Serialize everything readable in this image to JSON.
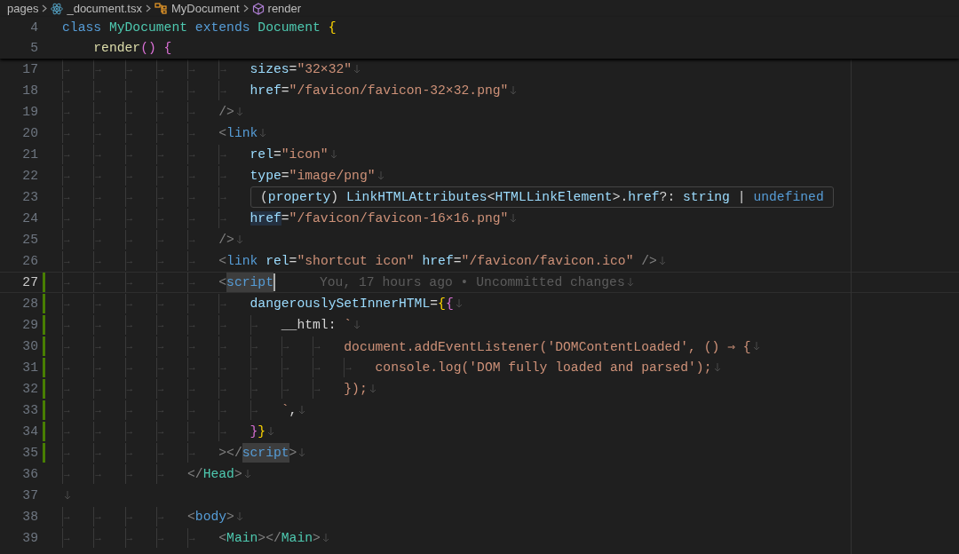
{
  "breadcrumb": [
    {
      "label": "pages",
      "kind": "folder"
    },
    {
      "label": "_document.tsx",
      "kind": "react-file"
    },
    {
      "label": "MyDocument",
      "kind": "class"
    },
    {
      "label": "render",
      "kind": "method"
    }
  ],
  "sticky_lines": [
    {
      "number": "4",
      "tokens": [
        {
          "text": "class ",
          "kind": "keyword"
        },
        {
          "text": "MyDocument",
          "kind": "type"
        },
        {
          "text": " extends ",
          "kind": "keyword"
        },
        {
          "text": "Document",
          "kind": "type"
        },
        {
          "text": " {",
          "kind": "bracket1"
        }
      ],
      "children": [
        {
          "number": "5",
          "tokens": [
            {
              "text": "render",
              "kind": "func"
            },
            {
              "text": "()",
              "kind": "bracket2"
            },
            {
              "text": " {",
              "kind": "bracket2"
            }
          ]
        }
      ]
    }
  ],
  "lines": [
    {
      "number": "17",
      "indent": [
        "→",
        "→",
        "→",
        "→",
        "→",
        "→"
      ],
      "current": false,
      "modified": false,
      "tokens": [
        {
          "text": "sizes",
          "kind": "attr"
        },
        {
          "text": "=",
          "kind": "plain"
        },
        {
          "text": "\"32×32\"",
          "kind": "string"
        }
      ]
    },
    {
      "number": "18",
      "indent": [
        "→",
        "→",
        "→",
        "→",
        "→",
        "→"
      ],
      "current": false,
      "modified": false,
      "tokens": [
        {
          "text": "href",
          "kind": "attr"
        },
        {
          "text": "=",
          "kind": "plain"
        },
        {
          "text": "\"/favicon/favicon-32×32.png\"",
          "kind": "string"
        }
      ]
    },
    {
      "number": "19",
      "indent": [
        "→",
        "→",
        "→",
        "→",
        "→"
      ],
      "current": false,
      "modified": false,
      "tokens": [
        {
          "text": "/>",
          "kind": "punct"
        }
      ]
    },
    {
      "number": "20",
      "indent": [
        "→",
        "→",
        "→",
        "→",
        "→"
      ],
      "current": false,
      "modified": false,
      "tokens": [
        {
          "text": "<",
          "kind": "punct"
        },
        {
          "text": "link",
          "kind": "tag"
        }
      ]
    },
    {
      "number": "21",
      "indent": [
        "→",
        "→",
        "→",
        "→",
        "→",
        "→"
      ],
      "current": false,
      "modified": false,
      "tokens": [
        {
          "text": "rel",
          "kind": "attr"
        },
        {
          "text": "=",
          "kind": "plain"
        },
        {
          "text": "\"icon\"",
          "kind": "string"
        }
      ]
    },
    {
      "number": "22",
      "indent": [
        "→",
        "→",
        "→",
        "→",
        "→",
        "→"
      ],
      "current": false,
      "modified": false,
      "tokens": [
        {
          "text": "type",
          "kind": "attr"
        },
        {
          "text": "=",
          "kind": "plain"
        },
        {
          "text": "\"image/png\"",
          "kind": "string"
        }
      ]
    },
    {
      "number": "23",
      "indent": [
        "→",
        "→",
        "→",
        "→",
        "→",
        "→"
      ],
      "current": false,
      "modified": false
    },
    {
      "number": "24",
      "indent": [
        "→",
        "→",
        "→",
        "→",
        "→",
        "→"
      ],
      "current": false,
      "modified": false,
      "tokens": [
        {
          "text": "href",
          "kind": "attr-hover"
        },
        {
          "text": "=",
          "kind": "plain"
        },
        {
          "text": "\"/favicon/favicon-16×16.png\"",
          "kind": "string"
        }
      ]
    },
    {
      "number": "25",
      "indent": [
        "→",
        "→",
        "→",
        "→",
        "→"
      ],
      "current": false,
      "modified": false,
      "tokens": [
        {
          "text": "/>",
          "kind": "punct"
        }
      ]
    },
    {
      "number": "26",
      "indent": [
        "→",
        "→",
        "→",
        "→",
        "→"
      ],
      "current": false,
      "modified": false,
      "tokens": [
        {
          "text": "<",
          "kind": "punct"
        },
        {
          "text": "link",
          "kind": "tag"
        },
        {
          "text": " rel",
          "kind": "attr"
        },
        {
          "text": "=",
          "kind": "plain"
        },
        {
          "text": "\"shortcut icon\"",
          "kind": "string"
        },
        {
          "text": " href",
          "kind": "attr"
        },
        {
          "text": "=",
          "kind": "plain"
        },
        {
          "text": "\"/favicon/favicon.ico\"",
          "kind": "string"
        },
        {
          "text": " />",
          "kind": "punct"
        }
      ]
    },
    {
      "number": "27",
      "indent": [
        "→",
        "→",
        "→",
        "→",
        "→"
      ],
      "current": true,
      "modified": true,
      "blame": "You, 17 hours ago • Uncommitted changes",
      "tokens": [
        {
          "text": "<",
          "kind": "punct"
        },
        {
          "text": "script",
          "kind": "tag-match"
        }
      ]
    },
    {
      "number": "28",
      "indent": [
        "→",
        "→",
        "→",
        "→",
        "→",
        "→"
      ],
      "current": false,
      "modified": true,
      "tokens": [
        {
          "text": "dangerouslySetInnerHTML",
          "kind": "attr"
        },
        {
          "text": "=",
          "kind": "plain"
        },
        {
          "text": "{",
          "kind": "bracket1"
        },
        {
          "text": "{",
          "kind": "bracket2"
        }
      ]
    },
    {
      "number": "29",
      "indent": [
        "→",
        "→",
        "→",
        "→",
        "→",
        "→",
        "→"
      ],
      "current": false,
      "modified": true,
      "tokens": [
        {
          "text": "__html",
          "kind": "plain"
        },
        {
          "text": ": ",
          "kind": "plain"
        },
        {
          "text": "`",
          "kind": "string"
        }
      ]
    },
    {
      "number": "30",
      "indent": [
        "→",
        "→",
        "→",
        "→",
        "→",
        "→",
        "→",
        "→",
        "→"
      ],
      "current": false,
      "modified": true,
      "tokens": [
        {
          "text": "document.addEventListener('DOMContentLoaded', () ⇒ {",
          "kind": "string"
        }
      ]
    },
    {
      "number": "31",
      "indent": [
        "→",
        "→",
        "→",
        "→",
        "→",
        "→",
        "→",
        "→",
        "→",
        "→"
      ],
      "current": false,
      "modified": true,
      "tokens": [
        {
          "text": "console.log('DOM fully loaded and parsed');",
          "kind": "string"
        }
      ]
    },
    {
      "number": "32",
      "indent": [
        "→",
        "→",
        "→",
        "→",
        "→",
        "→",
        "→",
        "→",
        "→"
      ],
      "current": false,
      "modified": true,
      "tokens": [
        {
          "text": "});",
          "kind": "string"
        }
      ]
    },
    {
      "number": "33",
      "indent": [
        "→",
        "→",
        "→",
        "→",
        "→",
        "→",
        "→"
      ],
      "current": false,
      "modified": true,
      "tokens": [
        {
          "text": "`",
          "kind": "string"
        },
        {
          "text": ",",
          "kind": "plain"
        }
      ]
    },
    {
      "number": "34",
      "indent": [
        "→",
        "→",
        "→",
        "→",
        "→",
        "→"
      ],
      "current": false,
      "modified": true,
      "tokens": [
        {
          "text": "}",
          "kind": "bracket2"
        },
        {
          "text": "}",
          "kind": "bracket1"
        }
      ]
    },
    {
      "number": "35",
      "indent": [
        "→",
        "→",
        "→",
        "→",
        "→"
      ],
      "current": false,
      "modified": true,
      "tokens": [
        {
          "text": ">",
          "kind": "punct"
        },
        {
          "text": "</",
          "kind": "punct"
        },
        {
          "text": "script",
          "kind": "tag-match"
        },
        {
          "text": ">",
          "kind": "punct"
        }
      ]
    },
    {
      "number": "36",
      "indent": [
        "→",
        "→",
        "→",
        "→"
      ],
      "current": false,
      "modified": false,
      "tokens": [
        {
          "text": "</",
          "kind": "punct"
        },
        {
          "text": "Head",
          "kind": "type"
        },
        {
          "text": ">",
          "kind": "punct"
        }
      ]
    },
    {
      "number": "37",
      "current": false,
      "modified": false
    },
    {
      "number": "38",
      "indent": [
        "→",
        "→",
        "→",
        "→"
      ],
      "current": false,
      "modified": false,
      "tokens": [
        {
          "text": "<",
          "kind": "punct"
        },
        {
          "text": "body",
          "kind": "tag"
        },
        {
          "text": ">",
          "kind": "punct"
        }
      ]
    },
    {
      "number": "39",
      "indent": [
        "→",
        "→",
        "→",
        "→",
        "→"
      ],
      "current": false,
      "modified": false,
      "tokens": [
        {
          "text": "<",
          "kind": "punct"
        },
        {
          "text": "Main",
          "kind": "type"
        },
        {
          "text": "></",
          "kind": "punct"
        },
        {
          "text": "Main",
          "kind": "type"
        },
        {
          "text": ">",
          "kind": "punct"
        }
      ]
    }
  ],
  "hover": {
    "tokens": [
      {
        "text": "(",
        "kind": "plain"
      },
      {
        "text": "property",
        "kind": "attr"
      },
      {
        "text": ") ",
        "kind": "plain"
      },
      {
        "text": "LinkHTMLAttributes",
        "kind": "attr"
      },
      {
        "text": "<",
        "kind": "plain"
      },
      {
        "text": "HTMLLinkElement",
        "kind": "attr"
      },
      {
        "text": ">.",
        "kind": "plain"
      },
      {
        "text": "href",
        "kind": "attr"
      },
      {
        "text": "?: ",
        "kind": "plain"
      },
      {
        "text": "string",
        "kind": "attr"
      },
      {
        "text": " | ",
        "kind": "plain"
      },
      {
        "text": "undefined",
        "kind": "keyword"
      }
    ]
  }
}
